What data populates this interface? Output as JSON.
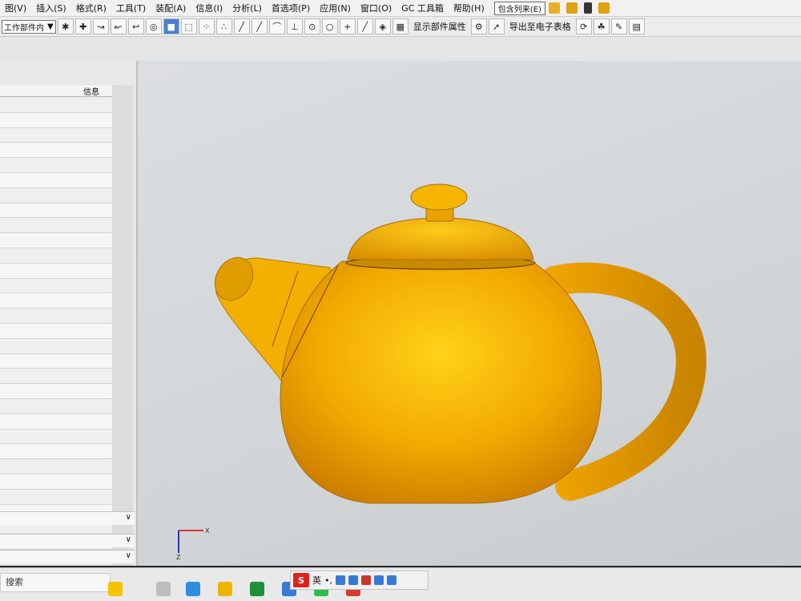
{
  "menu": {
    "items": [
      "图(V)",
      "插入(S)",
      "格式(R)",
      "工具(T)",
      "装配(A)",
      "信息(I)",
      "分析(L)",
      "首选项(P)",
      "应用(N)",
      "窗口(O)",
      "GC 工具箱",
      "帮助(H)"
    ],
    "combo_value": "包含列来(E)"
  },
  "toolbar": {
    "select_value": "工作部件内",
    "show_attr": "显示部件属性",
    "export": "导出至电子表格"
  },
  "nav": {
    "col_info": "信息"
  },
  "taskbar": {
    "search_label": "搜索",
    "ime_label": "英"
  },
  "colors": {
    "viewport_bg": "#d6d9db",
    "teapot": "#f2a900",
    "ime_brand": "#e0201c"
  }
}
